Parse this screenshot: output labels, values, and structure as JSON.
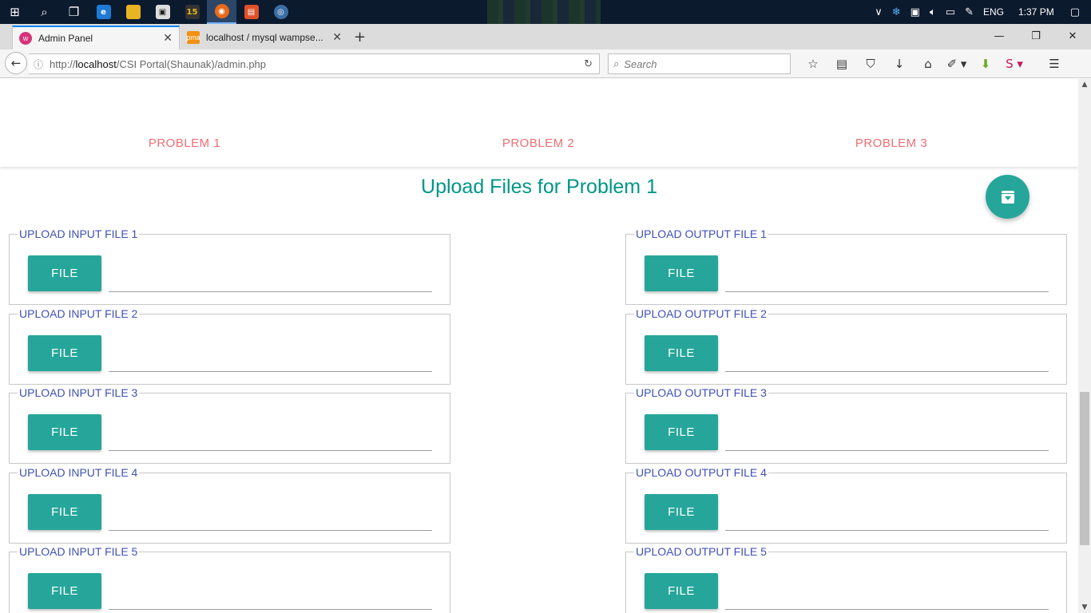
{
  "taskbar": {
    "clock": "1:37 PM",
    "language": "ENG",
    "apps": [
      "windows-start",
      "search",
      "task-view",
      "edge",
      "file-explorer",
      "store",
      "badge-15",
      "firefox",
      "app-orange",
      "app-mozilla"
    ]
  },
  "browser": {
    "tabs": [
      {
        "title": "Admin Panel"
      },
      {
        "title": "localhost / mysql wampse..."
      }
    ],
    "url_prefix": "http://",
    "url_host": "localhost",
    "url_path": "/CSI Portal(Shaunak)/admin.php",
    "search_placeholder": "Search"
  },
  "page": {
    "problem_tabs": [
      "PROBLEM 1",
      "PROBLEM 2",
      "PROBLEM 3"
    ],
    "heading": "Upload Files for Problem 1",
    "file_button_label": "FILE",
    "input_fields": [
      {
        "legend": "UPLOAD INPUT FILE 1"
      },
      {
        "legend": "UPLOAD INPUT FILE 2"
      },
      {
        "legend": "UPLOAD INPUT FILE 3"
      },
      {
        "legend": "UPLOAD INPUT FILE 4"
      },
      {
        "legend": "UPLOAD INPUT FILE 5"
      }
    ],
    "output_fields": [
      {
        "legend": "UPLOAD OUTPUT FILE 1"
      },
      {
        "legend": "UPLOAD OUTPUT FILE 2"
      },
      {
        "legend": "UPLOAD OUTPUT FILE 3"
      },
      {
        "legend": "UPLOAD OUTPUT FILE 4"
      },
      {
        "legend": "UPLOAD OUTPUT FILE 5"
      }
    ]
  },
  "colors": {
    "accent_teal": "#26a69a",
    "heading_teal": "#009688",
    "tab_red": "#ee6e73",
    "legend_indigo": "#3f51b5"
  }
}
